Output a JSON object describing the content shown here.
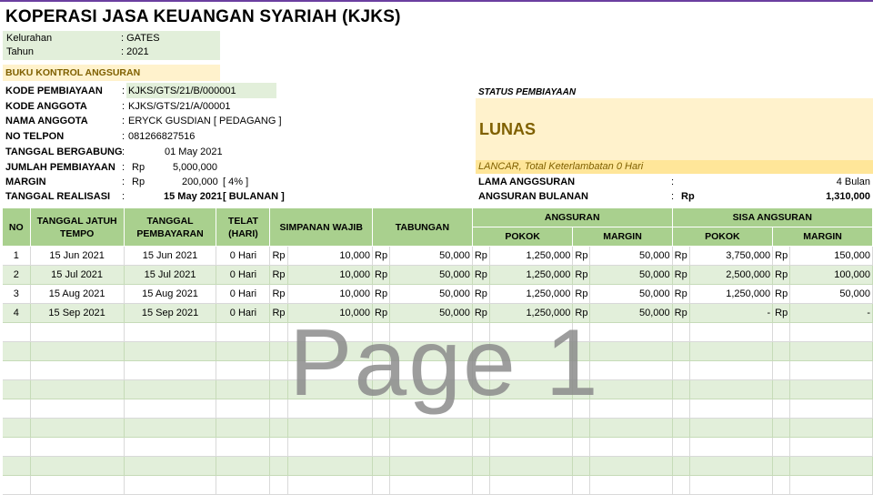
{
  "title": "KOPERASI JASA KEUANGAN SYARIAH (KJKS)",
  "location": {
    "kelurahan_label": "Kelurahan",
    "kelurahan_value": ": GATES",
    "tahun_label": "Tahun",
    "tahun_value": ": 2021"
  },
  "section_title": "BUKU KONTROL ANGSURAN",
  "info": {
    "kode_pembiayaan_label": "KODE PEMBIAYAAN",
    "kode_pembiayaan_value": "KJKS/GTS/21/B/000001",
    "kode_anggota_label": "KODE ANGGOTA",
    "kode_anggota_value": "KJKS/GTS/21/A/00001",
    "nama_anggota_label": "NAMA ANGGOTA",
    "nama_anggota_value": "ERYCK GUSDIAN [ PEDAGANG ]",
    "no_telpon_label": "NO TELPON",
    "no_telpon_value": "081266827516",
    "tanggal_bergabung_label": "TANGGAL BERGABUNG",
    "tanggal_bergabung_value": "01 May 2021",
    "jumlah_pembiayaan_label": "JUMLAH PEMBIAYAAN",
    "jumlah_pembiayaan_value": "5,000,000",
    "margin_label": "MARGIN",
    "margin_value": "200,000",
    "margin_pct": "[ 4% ]",
    "tanggal_realisasi_label": "TANGGAL REALISASI",
    "tanggal_realisasi_value": "15 May 2021",
    "tanggal_realisasi_mode": "[ BULANAN ]",
    "colon": ":",
    "rp": "Rp"
  },
  "status": {
    "label": "STATUS PEMBIAYAAN",
    "value": "LUNAS",
    "note": "LANCAR, Total Keterlambatan 0 Hari",
    "lama_label": "LAMA ANGGSURAN",
    "lama_value": "4 Bulan",
    "angsuran_label": "ANGSURAN BULANAN",
    "angsuran_rp": "Rp",
    "angsuran_value": "1,310,000"
  },
  "table": {
    "headers": {
      "no": "NO",
      "jatuh_tempo_1": "TANGGAL JATUH",
      "jatuh_tempo_2": "TEMPO",
      "pembayaran_1": "TANGGAL",
      "pembayaran_2": "PEMBAYARAN",
      "telat_1": "TELAT",
      "telat_2": "(HARI)",
      "simpanan_wajib": "SIMPANAN WAJIB",
      "tabungan": "TABUNGAN",
      "angsuran": "ANGSURAN",
      "angsuran_pokok": "POKOK",
      "angsuran_margin": "MARGIN",
      "sisa": "SISA ANGSURAN",
      "sisa_pokok": "POKOK",
      "sisa_margin": "MARGIN"
    },
    "rows": [
      {
        "no": "1",
        "tempo": "15 Jun 2021",
        "bayar": "15 Jun 2021",
        "telat": "0 Hari",
        "rp": "Rp",
        "simpanan": "10,000",
        "tabungan": "50,000",
        "pokok": "1,250,000",
        "margin": "50,000",
        "sisa_pokok": "3,750,000",
        "sisa_margin": "150,000"
      },
      {
        "no": "2",
        "tempo": "15 Jul 2021",
        "bayar": "15 Jul 2021",
        "telat": "0 Hari",
        "rp": "Rp",
        "simpanan": "10,000",
        "tabungan": "50,000",
        "pokok": "1,250,000",
        "margin": "50,000",
        "sisa_pokok": "2,500,000",
        "sisa_margin": "100,000"
      },
      {
        "no": "3",
        "tempo": "15 Aug 2021",
        "bayar": "15 Aug 2021",
        "telat": "0 Hari",
        "rp": "Rp",
        "simpanan": "10,000",
        "tabungan": "50,000",
        "pokok": "1,250,000",
        "margin": "50,000",
        "sisa_pokok": "1,250,000",
        "sisa_margin": "50,000"
      },
      {
        "no": "4",
        "tempo": "15 Sep 2021",
        "bayar": "15 Sep 2021",
        "telat": "0 Hari",
        "rp": "Rp",
        "simpanan": "10,000",
        "tabungan": "50,000",
        "pokok": "1,250,000",
        "margin": "50,000",
        "sisa_pokok": "-",
        "sisa_margin": "-"
      }
    ]
  },
  "watermark": "Page 1"
}
